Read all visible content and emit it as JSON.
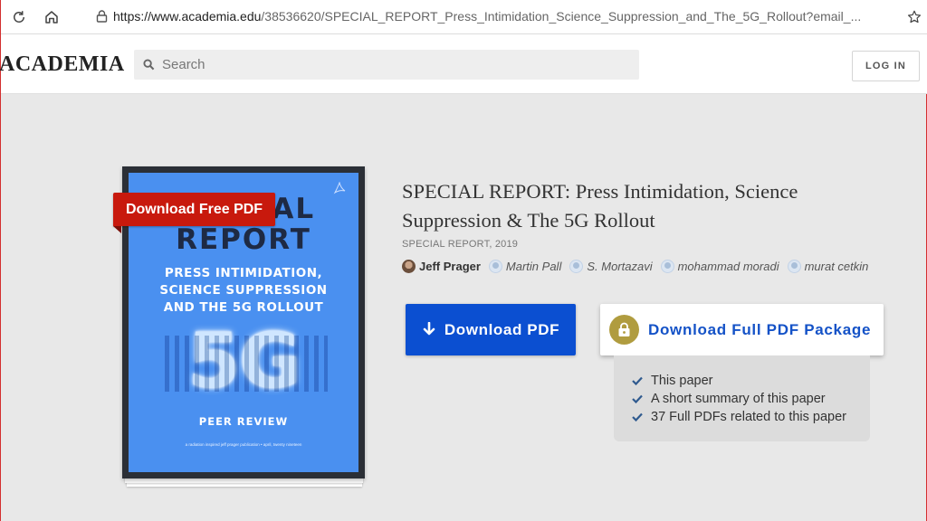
{
  "browser": {
    "url_host": "https://www.academia.edu",
    "url_path": "/38536620/SPECIAL_REPORT_Press_Intimidation_Science_Suppression_and_The_5G_Rollout?email_..."
  },
  "header": {
    "logo": "ACADEMIA",
    "search_placeholder": "Search",
    "login_label": "LOG IN"
  },
  "cover": {
    "title_line1": "SPECIAL",
    "title_line2": "REPORT",
    "subtitle_lines": [
      "PRESS INTIMIDATION,",
      "SCIENCE SUPPRESSION",
      "AND THE 5G ROLLOUT"
    ],
    "big_text": "5G",
    "peer_review": "PEER REVIEW",
    "footer": "a radiation inspired jeff prager publication • april, twenty nineteen",
    "download_badge": "Download Free PDF"
  },
  "paper": {
    "title": "SPECIAL REPORT: Press Intimidation, Science Suppression & The 5G Rollout",
    "meta": "SPECIAL REPORT, 2019",
    "authors": [
      {
        "name": "Jeff Prager"
      },
      {
        "name": "Martin Pall"
      },
      {
        "name": "S. Mortazavi"
      },
      {
        "name": "mohammad moradi"
      },
      {
        "name": "murat cetkin"
      }
    ]
  },
  "actions": {
    "download_pdf": "Download PDF",
    "download_package": "Download Full PDF Package",
    "package_items": [
      "This paper",
      "A short summary of this paper",
      "37 Full PDFs related to this paper"
    ]
  },
  "colors": {
    "primary_blue": "#0b4fd1",
    "badge_red": "#c8190d",
    "lock_gold": "#b09c3f",
    "cover_blue": "#4a90f0"
  }
}
